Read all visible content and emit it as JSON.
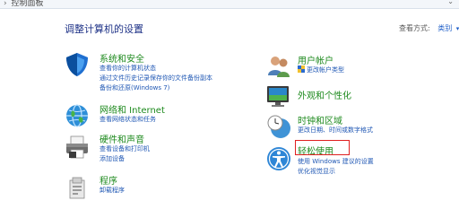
{
  "breadcrumb": {
    "text": "控制面板"
  },
  "heading": "调整计算机的设置",
  "view_by": {
    "label": "查看方式:",
    "value": "类别"
  },
  "left_categories": [
    {
      "title": "系统和安全",
      "links": [
        "查看你的计算机状态",
        "通过文件历史记录保存你的文件备份副本",
        "备份和还原(Windows 7)"
      ]
    },
    {
      "title": "网络和 Internet",
      "links": [
        "查看网络状态和任务"
      ]
    },
    {
      "title": "硬件和声音",
      "links": [
        "查看设备和打印机",
        "添加设备"
      ]
    },
    {
      "title": "程序",
      "links": [
        "卸载程序"
      ]
    }
  ],
  "right_categories": [
    {
      "title": "用户帐户",
      "links": [
        "更改帐户类型"
      ]
    },
    {
      "title": "外观和个性化",
      "links": []
    },
    {
      "title": "时钟和区域",
      "links": [
        "更改日期、时间或数字格式"
      ]
    },
    {
      "title": "轻松使用",
      "links": [
        "使用 Windows 建议的设置",
        "优化视觉显示"
      ]
    }
  ],
  "icons": {
    "system_security": "shield-icon",
    "network": "network-globe-icon",
    "hardware": "printer-icon",
    "programs": "programs-box-icon",
    "users": "users-icon",
    "appearance": "monitor-display-icon",
    "clock": "clock-globe-icon",
    "ease": "ease-of-access-icon"
  },
  "colors": {
    "heading": "#1e3287",
    "category_title": "#1e8a1e",
    "link": "#1f57b4",
    "highlight_box": "#e02020"
  }
}
